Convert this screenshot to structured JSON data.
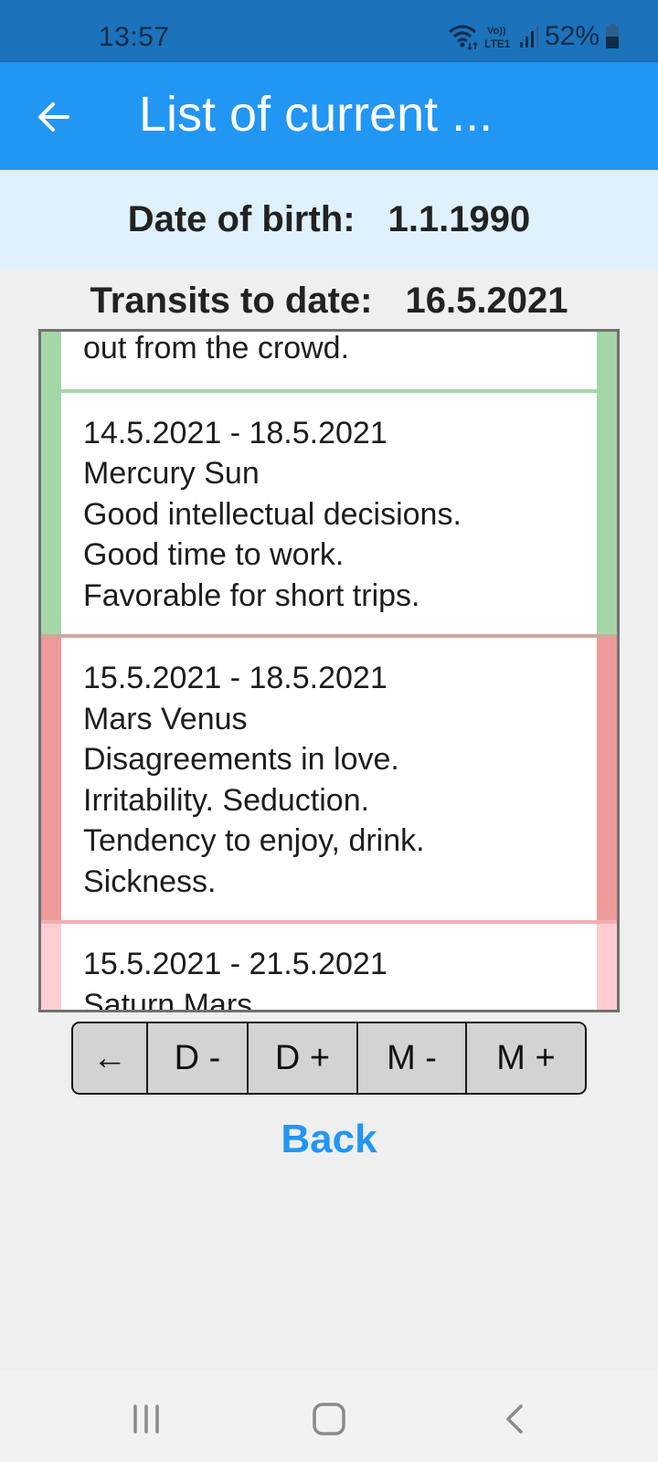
{
  "status_bar": {
    "time": "13:57",
    "network_label": "Vo)) LTE1",
    "battery_percent": "52%",
    "battery_level": 0.52,
    "icons": [
      "wifi-icon",
      "lte-icon",
      "signal-icon",
      "battery-icon"
    ]
  },
  "app_bar": {
    "title": "List of current ...",
    "back_icon": "arrow-left-icon"
  },
  "header": {
    "dob_label": "Date of birth:",
    "dob_value": "1.1.1990",
    "transits_label": "Transits to date:",
    "transits_value": "16.5.2021"
  },
  "transits": [
    {
      "type": "good",
      "color": "#a5d6a7",
      "lines": [
        "out from the crowd."
      ]
    },
    {
      "type": "good",
      "color": "#a5d6a7",
      "dates": "14.5.2021 - 18.5.2021",
      "planets": "Mercury Sun",
      "lines": [
        "Good intellectual decisions.",
        "Good time to work.",
        "Favorable for short trips."
      ]
    },
    {
      "type": "bad",
      "color": "#ef9a9a",
      "dates": "15.5.2021 - 18.5.2021",
      "planets": "Mars Venus",
      "lines": [
        "Disagreements in love.",
        "Irritability. Seduction.",
        "Tendency to enjoy, drink.",
        "Sickness."
      ]
    },
    {
      "type": "mild",
      "color": "#ffcdd2",
      "dates": "15.5.2021 - 21.5.2021",
      "planets": "Saturn Mars",
      "lines": []
    }
  ],
  "controls": {
    "buttons": [
      {
        "label": "←",
        "name": "prev-button"
      },
      {
        "label": "D -",
        "name": "day-minus-button"
      },
      {
        "label": "D +",
        "name": "day-plus-button"
      },
      {
        "label": "M -",
        "name": "month-minus-button"
      },
      {
        "label": "M +",
        "name": "month-plus-button"
      }
    ],
    "back_label": "Back"
  },
  "nav_bar": {
    "icons": [
      "recent-apps-icon",
      "home-icon",
      "back-icon"
    ]
  }
}
